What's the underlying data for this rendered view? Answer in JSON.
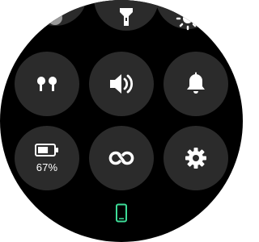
{
  "quick_settings": {
    "top_row": [
      {
        "name": "partial-toggle",
        "icon": "circle-icon"
      },
      {
        "name": "flashlight-toggle",
        "icon": "flashlight-icon"
      },
      {
        "name": "brightness-toggle",
        "icon": "brightness-icon"
      }
    ],
    "middle_row": [
      {
        "name": "earbuds-toggle",
        "icon": "earbuds-icon"
      },
      {
        "name": "sound-toggle",
        "icon": "volume-icon"
      },
      {
        "name": "notifications-toggle",
        "icon": "bell-icon"
      }
    ],
    "bottom_row": [
      {
        "name": "battery-tile",
        "icon": "battery-icon",
        "label": "67%",
        "level": 0.67
      },
      {
        "name": "sync-toggle",
        "icon": "infinity-loop-icon"
      },
      {
        "name": "settings-button",
        "icon": "gear-icon"
      }
    ]
  },
  "status": {
    "connected_device_icon": "phone-icon",
    "connected_color": "#3ddc97"
  },
  "colors": {
    "background": "#000000",
    "tile": "#2b2b2b",
    "icon": "#ffffff"
  }
}
